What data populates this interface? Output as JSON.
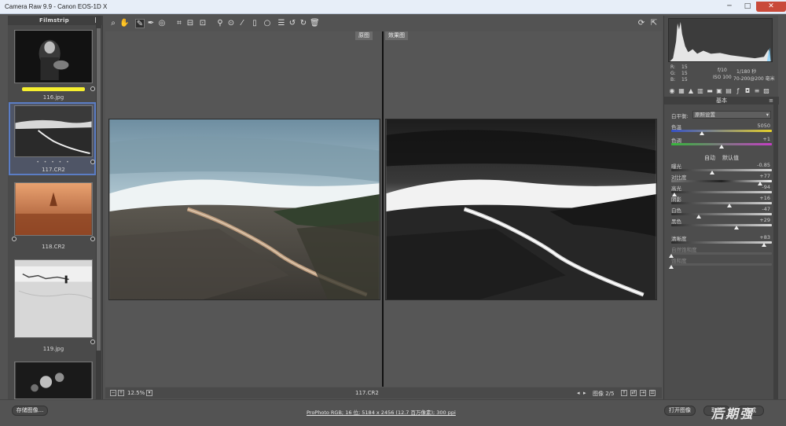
{
  "window": {
    "title": "Camera Raw 9.9 -  Canon EOS-1D X",
    "minimize": "─",
    "maximize": "□",
    "close": "✕"
  },
  "filmstrip": {
    "header": "Filmstrip",
    "items": [
      {
        "name": "116.jpg",
        "label_color": "#f6ef2e",
        "selected": false
      },
      {
        "name": "117.CR2",
        "rating": "• • • • •",
        "selected": true
      },
      {
        "name": "118.CR2",
        "selected": false
      },
      {
        "name": "119.jpg",
        "selected": false
      },
      {
        "name": "",
        "selected": false
      }
    ]
  },
  "toolbar": {
    "tools": [
      "zoom-icon",
      "hand-icon",
      "white-balance-icon",
      "color-sampler-icon",
      "targeted-adjust-icon",
      "crop-icon",
      "straighten-icon",
      "transform-icon",
      "spot-removal-icon",
      "red-eye-icon",
      "adjustment-brush-icon",
      "graduated-filter-icon",
      "radial-filter-icon",
      "preferences-icon",
      "rotate-left-icon",
      "rotate-right-icon",
      "trash-icon"
    ],
    "right_tools": [
      "sync-icon",
      "fullscreen-icon"
    ]
  },
  "preview": {
    "before_label": "原图",
    "after_label": "效果图",
    "file_label": "117.CR2",
    "zoom": "12.5%",
    "image_counter": "图像 2/5"
  },
  "histogram": {
    "r_label": "R:",
    "r_value": "15",
    "g_label": "G:",
    "g_value": "15",
    "b_label": "B:",
    "b_value": "15",
    "aperture": "f/10",
    "shutter": "1/180 秒",
    "iso": "ISO 100",
    "lens": "70-200@200 毫米"
  },
  "basic": {
    "header": "基本",
    "wb_label": "白平衡:",
    "wb_value": "原照设置",
    "temp_label": "色温",
    "temp_value": "5050",
    "tint_label": "色调",
    "tint_value": "+1",
    "auto_label": "自动",
    "default_label": "默认值",
    "sliders": [
      {
        "label": "曝光",
        "value": "-0.85",
        "level": 0.41
      },
      {
        "label": "对比度",
        "value": "+77",
        "level": 0.88
      },
      {
        "label": "高光",
        "value": "-94",
        "level": 0.03
      },
      {
        "label": "阴影",
        "value": "+16",
        "level": 0.58
      },
      {
        "label": "白色",
        "value": "-47",
        "level": 0.27
      },
      {
        "label": "黑色",
        "value": "+29",
        "level": 0.65
      },
      {
        "label": "清晰度",
        "value": "+83",
        "level": 0.92
      },
      {
        "label": "自然饱和度",
        "value": "",
        "level": 0.0
      },
      {
        "label": "饱和度",
        "value": "",
        "level": 0.0
      }
    ]
  },
  "bottom": {
    "save_label": "存储图像...",
    "workflow": "ProPhoto RGB; 16 位; 5184 x 2456 (12.7 百万像素); 300 ppi",
    "open_label": "打开图像",
    "cancel_label": "取消",
    "done_label": "完成",
    "watermark": "后期强"
  }
}
